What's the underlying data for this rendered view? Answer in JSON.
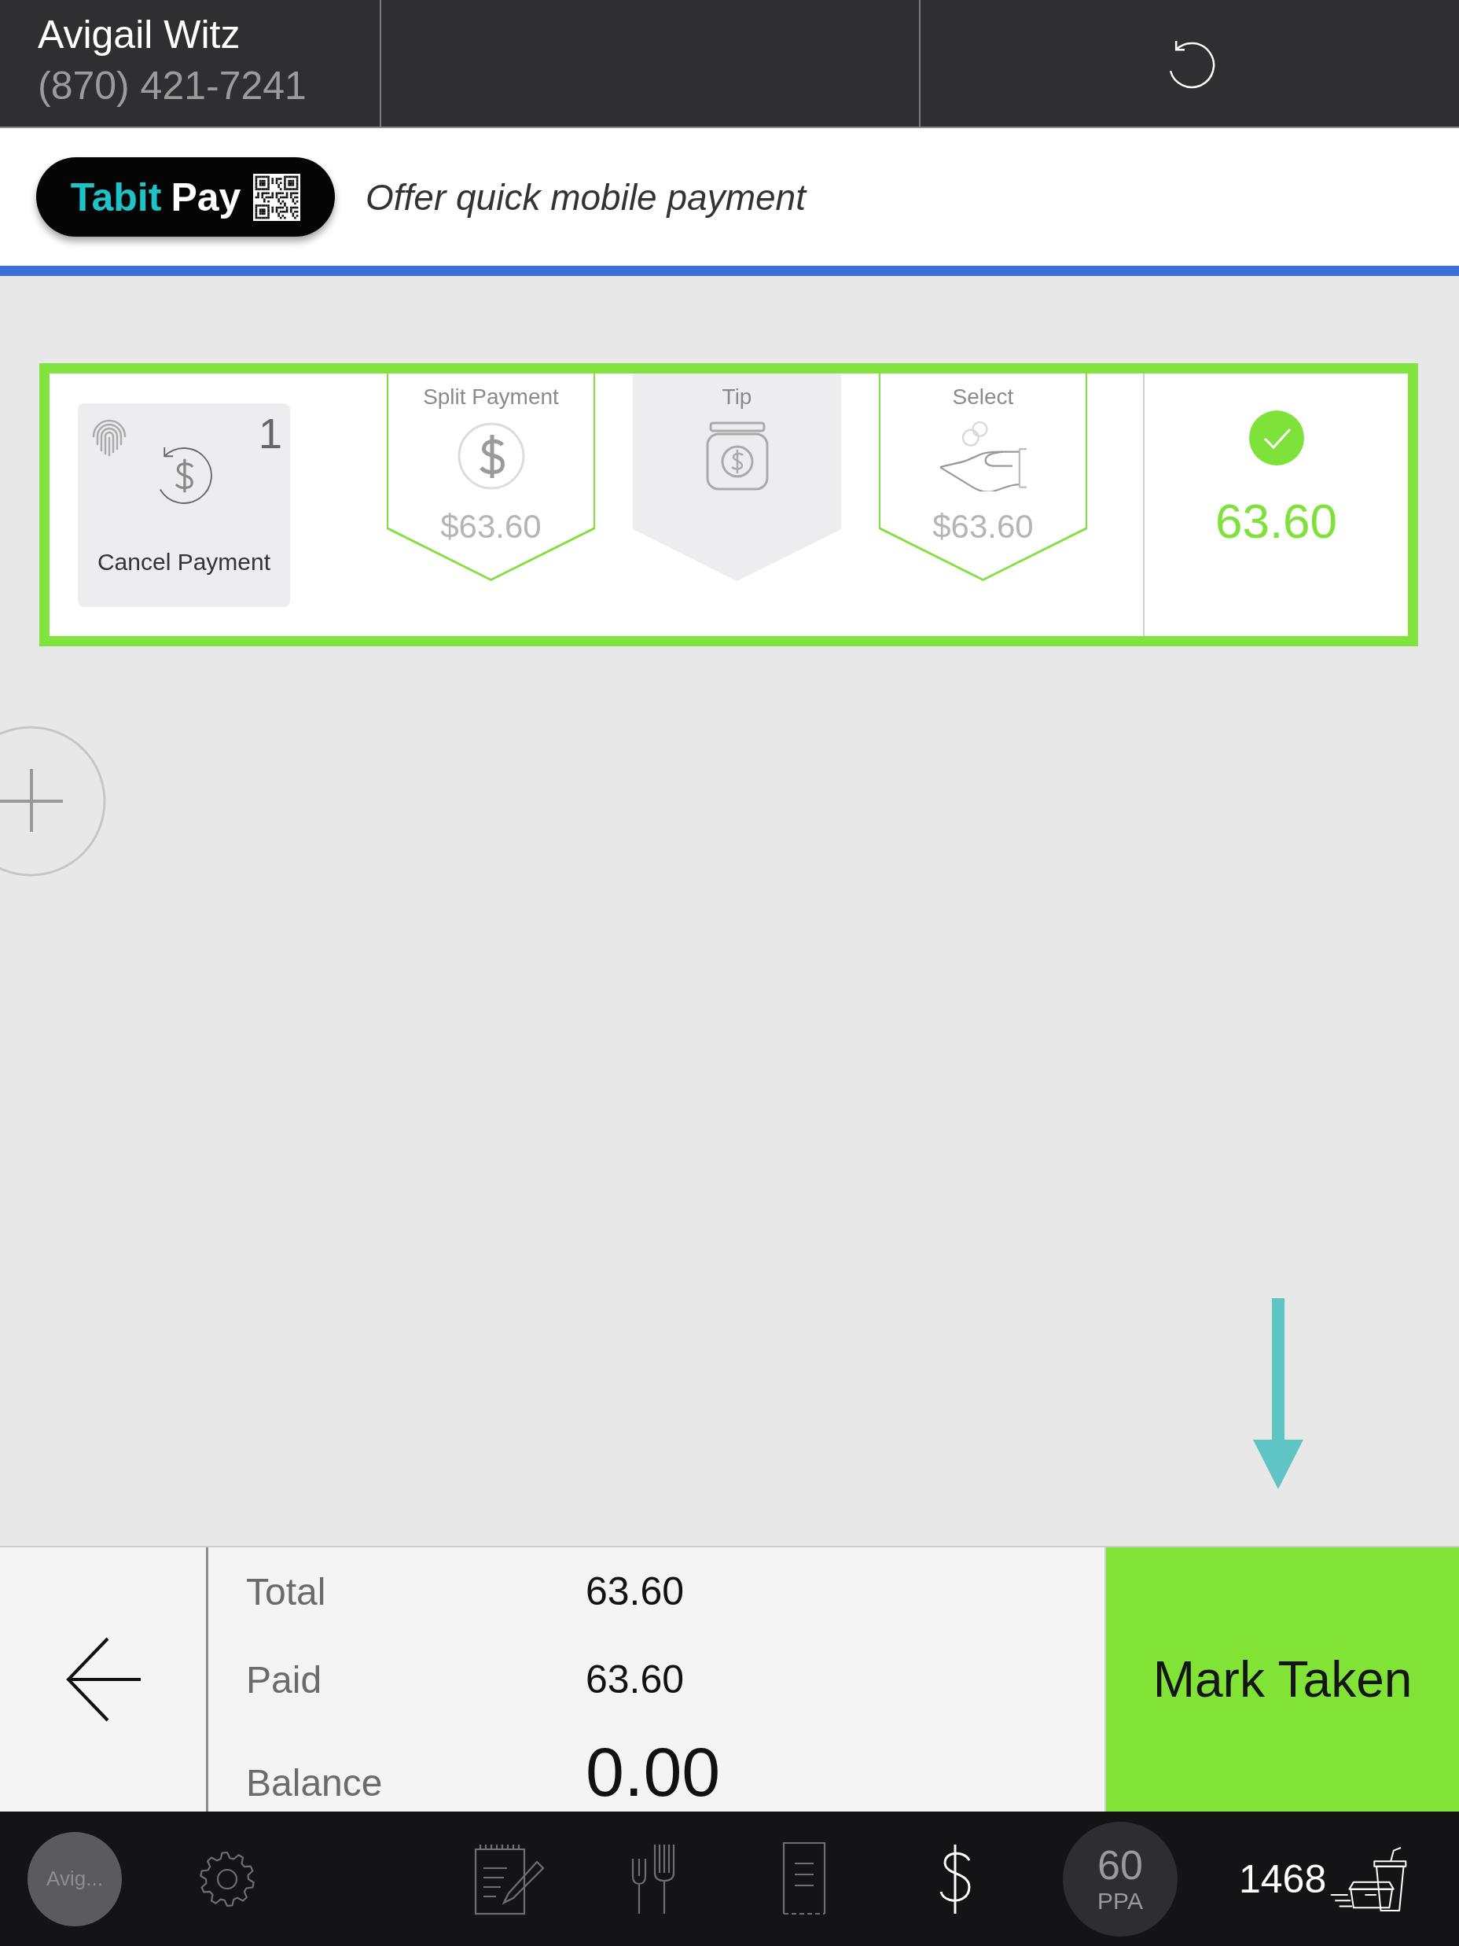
{
  "header": {
    "customer_name": "Avigail Witz",
    "customer_phone": "(870) 421-7241"
  },
  "tabit_pay": {
    "brand": "Tabit",
    "brand_suffix": "Pay",
    "caption": "Offer quick mobile payment"
  },
  "payment": {
    "cancel": {
      "label": "Cancel Payment",
      "count": "1"
    },
    "steps": [
      {
        "kind": "split",
        "label": "Split Payment",
        "amount": "$63.60",
        "highlighted": true
      },
      {
        "kind": "tip",
        "label": "Tip",
        "highlighted": false
      },
      {
        "kind": "select",
        "label": "Select",
        "amount": "$63.60",
        "highlighted": true
      }
    ],
    "status": {
      "done": true,
      "amount": "63.60"
    }
  },
  "summary": {
    "rows": [
      {
        "kind": "normal",
        "label": "Total",
        "value": "63.60"
      },
      {
        "kind": "normal",
        "label": "Paid",
        "value": "63.60"
      },
      {
        "kind": "emphasis",
        "label": "Balance",
        "value": "0.00"
      }
    ],
    "action": "Mark Taken"
  },
  "nav": {
    "avatar_label": "Avig...",
    "tabs": [
      {
        "kind": "notes",
        "selected": false
      },
      {
        "kind": "menu",
        "selected": false
      },
      {
        "kind": "check",
        "selected": false
      },
      {
        "kind": "payment",
        "selected": true
      }
    ],
    "ppa": {
      "value": "60",
      "label": "PPA"
    },
    "orders": {
      "count": "1468"
    }
  }
}
